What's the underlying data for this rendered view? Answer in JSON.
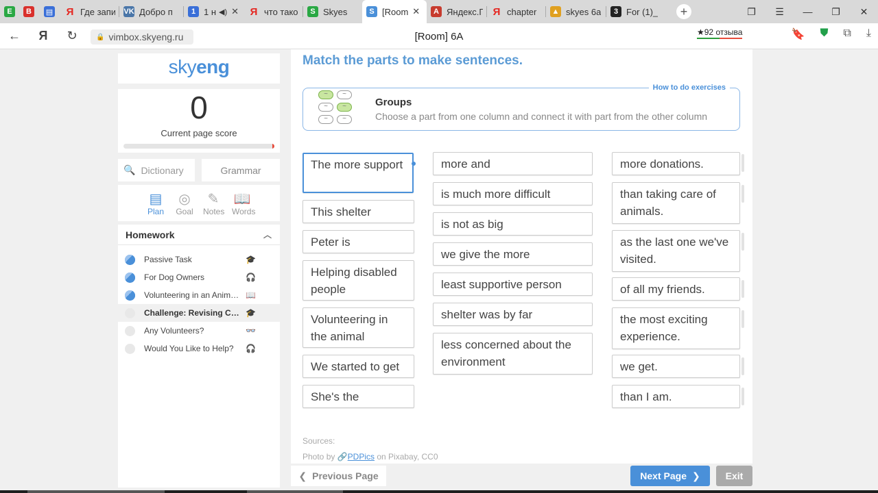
{
  "browser": {
    "tabs": [
      {
        "title": "",
        "icon": "E",
        "color": "#2aa844"
      },
      {
        "title": "",
        "icon": "B",
        "color": "#d9302c"
      },
      {
        "title": "",
        "icon": "doc",
        "color": "#3a6fd8"
      },
      {
        "title": "Где запи",
        "icon": "Я",
        "color": "#e52620"
      },
      {
        "title": "Добро п",
        "icon": "VK",
        "color": "#4a76a8"
      },
      {
        "title": "1 н",
        "icon": "1",
        "color": "#3a6fd8"
      },
      {
        "title": "что тако",
        "icon": "Я",
        "color": "#e52620"
      },
      {
        "title": "Skyes",
        "icon": "S",
        "color": "#2aa844"
      },
      {
        "title": "[Room",
        "icon": "S",
        "color": "#4a90d9"
      },
      {
        "title": "Яндекс.П",
        "icon": "A",
        "color": "#c73b2e"
      },
      {
        "title": "chapter",
        "icon": "Я",
        "color": "#e52620"
      },
      {
        "title": "skyes 6a",
        "icon": "img",
        "color": "#e0a020"
      },
      {
        "title": "For (1)_",
        "icon": "3",
        "color": "#222222"
      }
    ],
    "url": "vimbox.skyeng.ru",
    "page_title": "[Room] 6A",
    "reviews": "★92 отзыва"
  },
  "sidebar": {
    "logo_light": "sky",
    "logo_bold": "eng",
    "score": "0",
    "score_label": "Current page score",
    "dictionary_placeholder": "Dictionary",
    "grammar_label": "Grammar",
    "nav": [
      {
        "label": "Plan",
        "icon": "plan-icon",
        "active": true
      },
      {
        "label": "Goal",
        "icon": "goal-icon",
        "active": false
      },
      {
        "label": "Notes",
        "icon": "notes-icon",
        "active": false
      },
      {
        "label": "Words",
        "icon": "words-icon",
        "active": false
      }
    ],
    "homework_title": "Homework",
    "homework": [
      {
        "name": "Passive Task",
        "done": true,
        "type": "grammar-icon"
      },
      {
        "name": "For Dog Owners",
        "done": true,
        "type": "listening-icon"
      },
      {
        "name": "Volunteering in an Anima...",
        "done": true,
        "type": "reading-icon"
      },
      {
        "name": "Challenge: Revising Com...",
        "done": false,
        "type": "grammar-icon",
        "selected": true
      },
      {
        "name": "Any Volunteers?",
        "done": false,
        "type": "video-icon"
      },
      {
        "name": "Would You Like to Help?",
        "done": false,
        "type": "listening-icon"
      }
    ]
  },
  "main": {
    "heading": "Match the parts to make sentences.",
    "how_to": "How to do exercises",
    "groups_title": "Groups",
    "groups_desc": "Choose a part from one column and connect it with part from the other column",
    "col1": [
      "The more support",
      "This shelter",
      "Peter is",
      "Helping disabled people",
      "Volunteering in the animal",
      "We started to get",
      "She's the"
    ],
    "col2": [
      "more and",
      "is much more difficult",
      "is not as big",
      "we give the more",
      "least supportive person",
      "shelter was by far",
      "less concerned about the environment"
    ],
    "col3": [
      "more donations.",
      "than taking care of animals.",
      "as the last one we've visited.",
      "of all my friends.",
      "the most exciting experience.",
      "we get.",
      "than I am."
    ],
    "sources_label": "Sources:",
    "photo_prefix": "Photo by",
    "photo_link": "PDPics",
    "photo_suffix": "on Pixabay, CC0"
  },
  "footer": {
    "prev": "Previous Page",
    "next": "Next Page",
    "exit": "Exit"
  }
}
